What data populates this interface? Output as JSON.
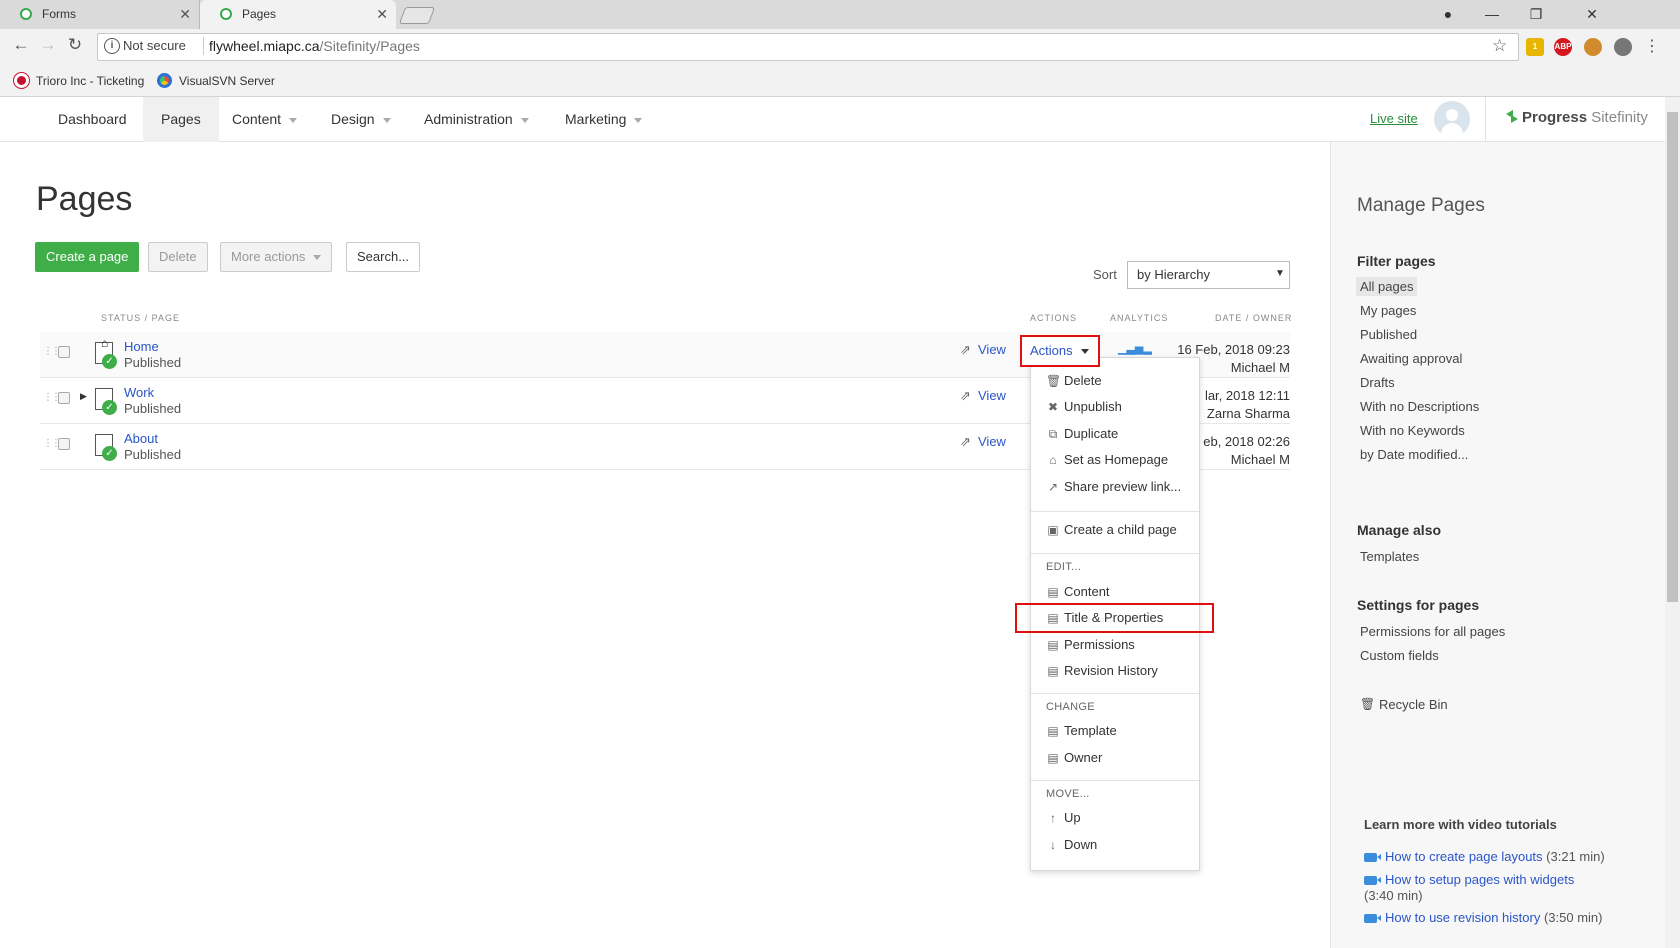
{
  "browser": {
    "tabs": [
      {
        "label": "Forms",
        "active": false
      },
      {
        "label": "Pages",
        "active": true
      }
    ],
    "security_text": "Not secure",
    "url_host": "flywheel.miapc.ca",
    "url_path": "/Sitefinity/Pages",
    "bookmarks": [
      {
        "label": "Trioro Inc - Ticketing"
      },
      {
        "label": "VisualSVN Server"
      }
    ]
  },
  "app_nav": {
    "items": [
      {
        "label": "Dashboard",
        "has_caret": false
      },
      {
        "label": "Pages",
        "has_caret": false,
        "active": true
      },
      {
        "label": "Content",
        "has_caret": true
      },
      {
        "label": "Design",
        "has_caret": true
      },
      {
        "label": "Administration",
        "has_caret": true
      },
      {
        "label": "Marketing",
        "has_caret": true
      }
    ],
    "live_site": "Live site",
    "logo_progress": "Progress",
    "logo_sitefinity": "Sitefinity"
  },
  "main": {
    "title": "Pages",
    "buttons": {
      "create": "Create a page",
      "delete": "Delete",
      "more": "More actions",
      "search": "Search..."
    },
    "sort_label": "Sort",
    "sort_value": "by Hierarchy",
    "columns": {
      "status_page": "STATUS / PAGE",
      "actions": "ACTIONS",
      "analytics": "ANALYTICS",
      "date_owner": "DATE / OWNER"
    },
    "rows": [
      {
        "name": "Home",
        "status": "Published",
        "view": "View",
        "date": "16 Feb, 2018 09:23",
        "owner": "Michael M"
      },
      {
        "name": "Work",
        "status": "Published",
        "view": "View",
        "date": "lar, 2018 12:11",
        "owner": "Zarna Sharma"
      },
      {
        "name": "About",
        "status": "Published",
        "view": "View",
        "date": "eb, 2018 02:26",
        "owner": "Michael M"
      }
    ],
    "actions_label": "Actions"
  },
  "actions_menu": {
    "group1": [
      {
        "label": "Delete",
        "icon": "trash-icon"
      },
      {
        "label": "Unpublish",
        "icon": "x-icon"
      },
      {
        "label": "Duplicate",
        "icon": "duplicate-icon"
      },
      {
        "label": "Set as Homepage",
        "icon": "home-icon"
      },
      {
        "label": "Share preview link...",
        "icon": "share-icon"
      }
    ],
    "create_child": "Create a child page",
    "edit_header": "EDIT...",
    "edit_items": [
      "Content",
      "Title & Properties",
      "Permissions",
      "Revision History"
    ],
    "change_header": "CHANGE",
    "change_items": [
      "Template",
      "Owner"
    ],
    "move_header": "MOVE...",
    "move_items": [
      "Up",
      "Down"
    ]
  },
  "sidebar": {
    "title": "Manage Pages",
    "filter_heading": "Filter pages",
    "filters": [
      "All pages",
      "My pages",
      "Published",
      "Awaiting approval",
      "Drafts",
      "With no Descriptions",
      "With no Keywords",
      "by Date modified..."
    ],
    "manage_also_heading": "Manage also",
    "manage_also": [
      "Templates"
    ],
    "settings_heading": "Settings for pages",
    "settings": [
      "Permissions for all pages",
      "Custom fields"
    ],
    "recycle_bin": "Recycle Bin",
    "videos_heading": "Learn more with video tutorials",
    "videos": [
      {
        "title": "How to create page layouts",
        "duration": "(3:21 min)"
      },
      {
        "title": "How to setup pages with widgets",
        "duration": "(3:40 min)"
      },
      {
        "title": "How to use revision history",
        "duration": "(3:50 min)"
      }
    ]
  },
  "colors": {
    "accent_green": "#3fae49",
    "link_blue": "#2a55c9",
    "highlight_red": "#e01010"
  }
}
